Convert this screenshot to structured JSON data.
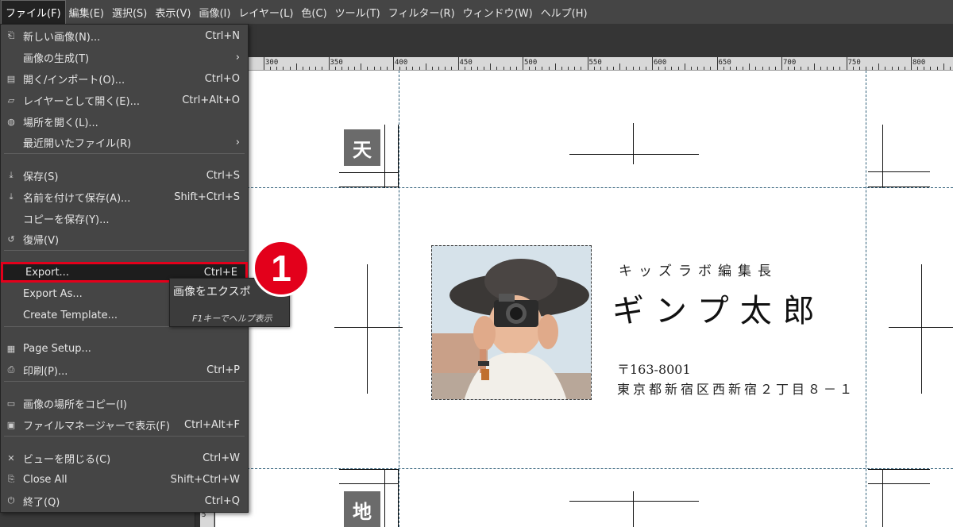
{
  "menubar": [
    {
      "label": "ファイル(F)"
    },
    {
      "label": "編集(E)"
    },
    {
      "label": "選択(S)"
    },
    {
      "label": "表示(V)"
    },
    {
      "label": "画像(I)"
    },
    {
      "label": "レイヤー(L)"
    },
    {
      "label": "色(C)"
    },
    {
      "label": "ツール(T)"
    },
    {
      "label": "フィルター(R)"
    },
    {
      "label": "ウィンドウ(W)"
    },
    {
      "label": "ヘルプ(H)"
    }
  ],
  "file_menu": [
    {
      "icon": "⎗",
      "label": "新しい画像(N)...",
      "shortcut": "Ctrl+N"
    },
    {
      "icon": "",
      "label": "画像の生成(T)",
      "shortcut": "›"
    },
    {
      "icon": "▤",
      "label": "開く/インポート(O)...",
      "shortcut": "Ctrl+O"
    },
    {
      "icon": "▱",
      "label": "レイヤーとして開く(E)...",
      "shortcut": "Ctrl+Alt+O"
    },
    {
      "icon": "◍",
      "label": "場所を開く(L)...",
      "shortcut": ""
    },
    {
      "icon": "",
      "label": "最近開いたファイル(R)",
      "shortcut": "›"
    },
    {
      "icon": "⤓",
      "label": "保存(S)",
      "shortcut": "Ctrl+S"
    },
    {
      "icon": "⤓",
      "label": "名前を付けて保存(A)...",
      "shortcut": "Shift+Ctrl+S"
    },
    {
      "icon": "",
      "label": "コピーを保存(Y)...",
      "shortcut": ""
    },
    {
      "icon": "↺",
      "label": "復帰(V)",
      "shortcut": ""
    },
    {
      "icon": "",
      "label": "Export...",
      "shortcut": "Ctrl+E"
    },
    {
      "icon": "",
      "label": "Export As...",
      "shortcut": ""
    },
    {
      "icon": "",
      "label": "Create Template...",
      "shortcut": ""
    },
    {
      "icon": "▦",
      "label": "Page Setup...",
      "shortcut": ""
    },
    {
      "icon": "⎙",
      "label": "印刷(P)...",
      "shortcut": "Ctrl+P"
    },
    {
      "icon": "▭",
      "label": "画像の場所をコピー(I)",
      "shortcut": ""
    },
    {
      "icon": "▣",
      "label": "ファイルマネージャーで表示(F)",
      "shortcut": "Ctrl+Alt+F"
    },
    {
      "icon": "✕",
      "label": "ビューを閉じる(C)",
      "shortcut": "Ctrl+W"
    },
    {
      "icon": "⎘",
      "label": "Close All",
      "shortcut": "Shift+Ctrl+W"
    },
    {
      "icon": "⏻",
      "label": "終了(Q)",
      "shortcut": "Ctrl+Q"
    }
  ],
  "tooltip": {
    "title": "画像をエクスポ",
    "hint": "F1キーでヘルプ表示"
  },
  "step_number": "1",
  "ruler": {
    "labels": [
      "300",
      "350",
      "400",
      "450",
      "500",
      "550",
      "600",
      "650",
      "700",
      "750",
      "800"
    ]
  },
  "canvas": {
    "badge_top": "天",
    "badge_bottom": "地"
  },
  "card": {
    "title": "キッズラボ編集長",
    "name": "ギンプ太郎",
    "postal": "〒163-8001",
    "address": "東京都新宿区西新宿２丁目８－１"
  },
  "colors": {
    "highlight": "#e3001b",
    "guide": "#2e5e78",
    "menu_bg": "#454545"
  }
}
